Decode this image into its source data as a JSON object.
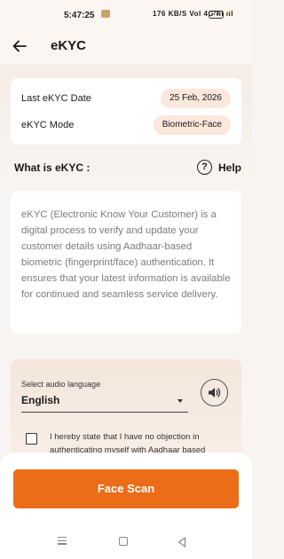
{
  "status_bar": {
    "time": "5:47:25",
    "network": "176 KB/S   Vol   4G ııl ııl",
    "battery": "73"
  },
  "header": {
    "title": "eKYC"
  },
  "info": {
    "last_date_label": "Last eKYC Date",
    "last_date_value": "25 Feb, 2026",
    "mode_label": "eKYC Mode",
    "mode_value": "Biometric-Face"
  },
  "section": {
    "heading": "What is eKYC :",
    "help_label": "Help"
  },
  "description": "eKYC (Electronic Know Your Customer) is a digital process to verify and update your customer details using Aadhaar-based biometric (fingerprint/face) authentication. It ensures that your latest information is available for continued and seamless service delivery.",
  "language": {
    "caption": "Select audio language",
    "selected": "English"
  },
  "consent": {
    "text": "I hereby state that I have no objection in authenticating myself with Aadhaar based"
  },
  "actions": {
    "face_scan_label": "Face Scan"
  },
  "colors": {
    "accent": "#ec6d17",
    "pill_bg": "#fbe8dc"
  },
  "icons": {
    "back": "arrow-left-icon",
    "help": "question-circle-icon",
    "speaker": "speaker-icon",
    "dropdown": "caret-down-icon"
  }
}
